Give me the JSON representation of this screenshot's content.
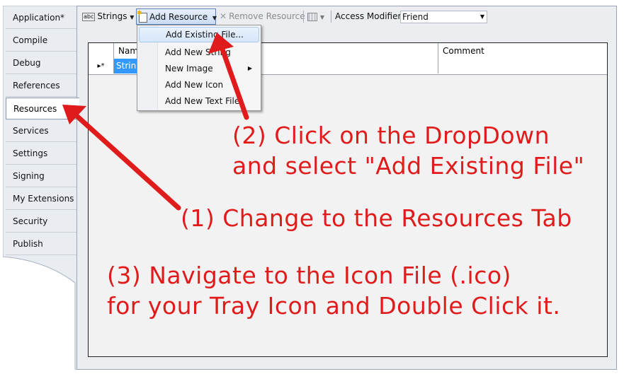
{
  "tabs": [
    {
      "label": "Application*"
    },
    {
      "label": "Compile"
    },
    {
      "label": "Debug"
    },
    {
      "label": "References"
    },
    {
      "label": "Resources"
    },
    {
      "label": "Services"
    },
    {
      "label": "Settings"
    },
    {
      "label": "Signing"
    },
    {
      "label": "My Extensions"
    },
    {
      "label": "Security"
    },
    {
      "label": "Publish"
    }
  ],
  "active_tab": "Resources",
  "toolbar": {
    "strings_label": "Strings",
    "strings_icon_text": "abc",
    "add_resource_label": "Add Resource",
    "remove_resource_label": "Remove Resource",
    "access_modifier_label": "Access Modifier:",
    "access_modifier_value": "Friend"
  },
  "grid": {
    "columns": [
      "Name",
      "Comment"
    ],
    "new_row_marker": "▸*",
    "selected_cell_text": "String"
  },
  "menu": {
    "items": [
      {
        "label": "Add Existing File..."
      },
      {
        "label": "Add New String"
      },
      {
        "label": "New Image"
      },
      {
        "label": "Add New Icon"
      },
      {
        "label": "Add New Text File"
      }
    ]
  },
  "annotations": {
    "step2_line1": "(2) Click on the DropDown",
    "step2_line2": "and select \"Add Existing File\"",
    "step1": "(1) Change to the Resources Tab",
    "step3_line1": "(3) Navigate to the Icon File (.ico)",
    "step3_line2": "for your Tray Icon and Double Click it."
  },
  "colors": {
    "annotation": "#e01b1b",
    "selection": "#3399ff"
  }
}
